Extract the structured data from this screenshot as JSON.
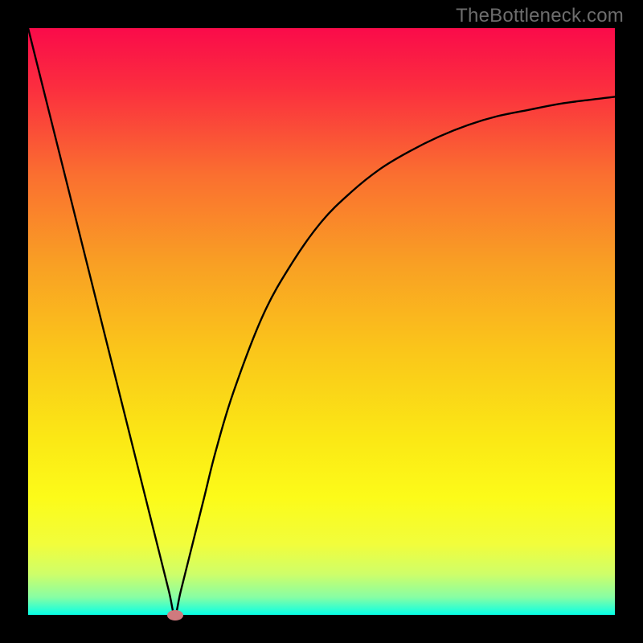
{
  "watermark": "TheBottleneck.com",
  "chart_data": {
    "type": "line",
    "title": "",
    "xlabel": "",
    "ylabel": "",
    "xlim": [
      0,
      100
    ],
    "ylim": [
      0,
      100
    ],
    "grid": false,
    "legend": false,
    "series": [
      {
        "name": "bottleneck-curve",
        "x": [
          0,
          5,
          10,
          15,
          20,
          22,
          24,
          25,
          26,
          28,
          30,
          32,
          35,
          40,
          45,
          50,
          55,
          60,
          65,
          70,
          75,
          80,
          85,
          90,
          95,
          100
        ],
        "y": [
          100,
          80,
          60,
          40,
          20,
          12,
          4,
          0,
          4,
          12,
          20,
          28,
          38,
          51,
          60,
          67,
          72,
          76,
          79,
          81.5,
          83.5,
          85,
          86,
          87,
          87.7,
          88.3
        ]
      }
    ],
    "marker": {
      "x": 25,
      "y": 0,
      "color": "#cf7a7e"
    },
    "gradient_stops": [
      {
        "offset": 0.0,
        "color": "#fa0b4a"
      },
      {
        "offset": 0.1,
        "color": "#fb2d3f"
      },
      {
        "offset": 0.25,
        "color": "#fa6f30"
      },
      {
        "offset": 0.4,
        "color": "#f99f24"
      },
      {
        "offset": 0.55,
        "color": "#fac61a"
      },
      {
        "offset": 0.7,
        "color": "#fbe815"
      },
      {
        "offset": 0.8,
        "color": "#fcfb19"
      },
      {
        "offset": 0.88,
        "color": "#f1fd3c"
      },
      {
        "offset": 0.93,
        "color": "#cffe69"
      },
      {
        "offset": 0.97,
        "color": "#87fea4"
      },
      {
        "offset": 1.0,
        "color": "#06ffe7"
      }
    ]
  }
}
